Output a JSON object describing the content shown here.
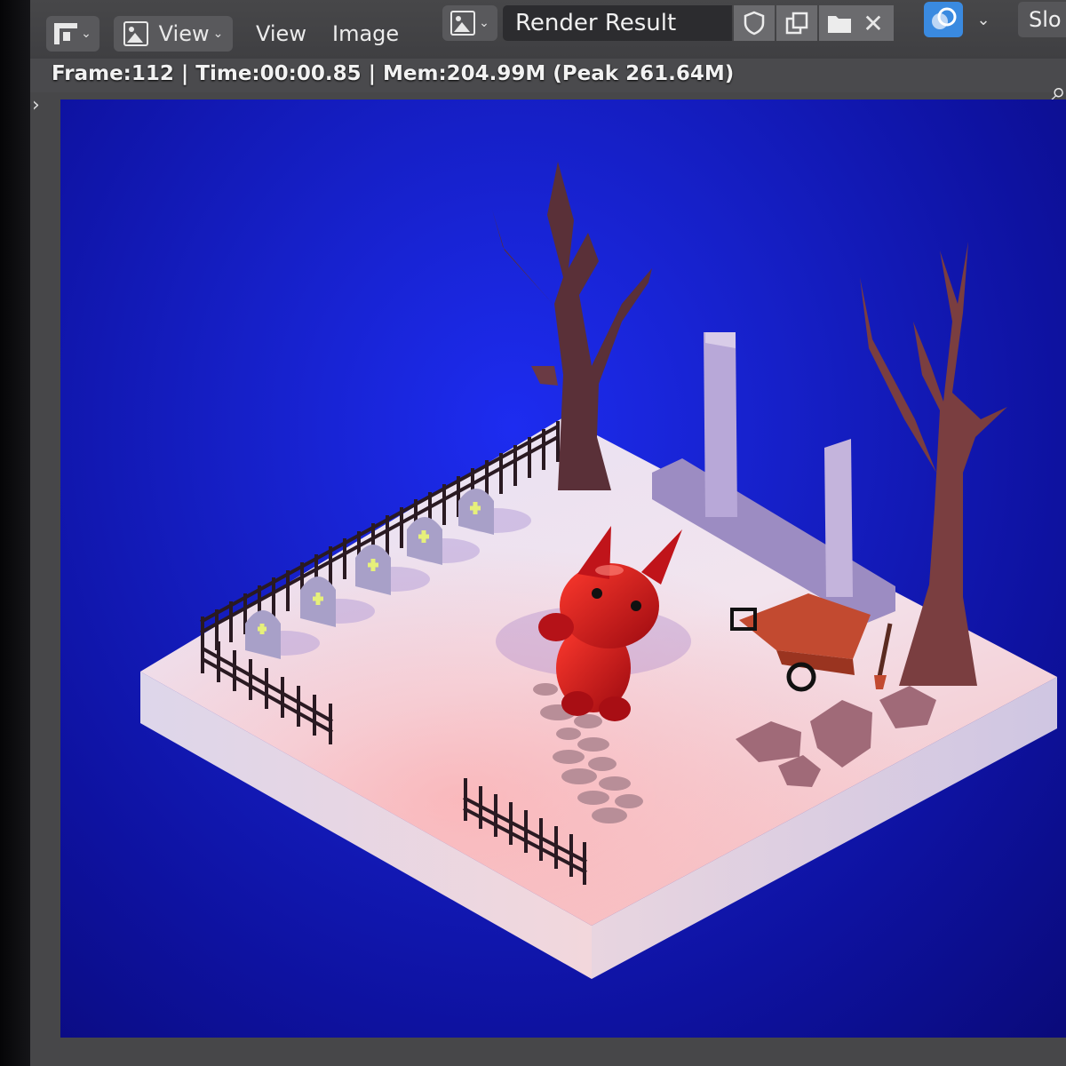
{
  "header": {
    "view_dropdown_label": "View",
    "menu_view": "View",
    "menu_image": "Image",
    "image_name": "Render Result",
    "slot_label": "Slo"
  },
  "stats": "Frame:112 | Time:00:00.85 | Mem:204.99M (Peak 261.64M)",
  "colors": {
    "background_blue": "#1620c8",
    "ground": "#eae4f0",
    "devil": "#c81818",
    "tree": "#5a3038"
  }
}
